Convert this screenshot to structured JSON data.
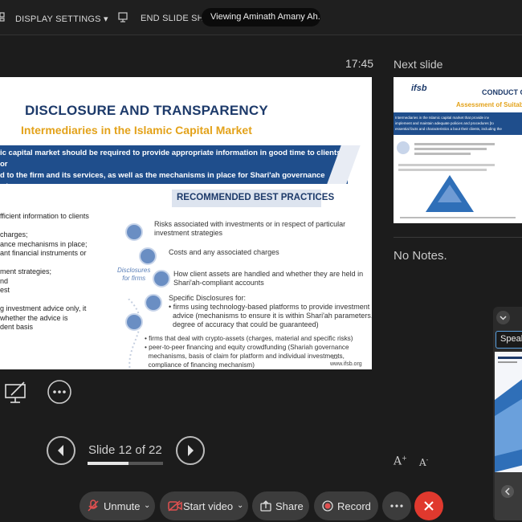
{
  "toolbar_top": {
    "display_settings": "DISPLAY SETTINGS ▾",
    "end_slide_show": "END SLIDE SHOW",
    "viewing": "Viewing Aminath Amany Ah..."
  },
  "presenter": {
    "timer": "17:45",
    "slide_counter": "Slide 12 of 22",
    "progress": 0.545
  },
  "slide": {
    "title": "DISCLOSURE AND TRANSPARENCY",
    "subtitle": "Intermediaries in the Islamic Capital Market",
    "banner": "ic capital market should be required to provide appropriate information in good time to clients or\nd to the firm and its services, as well as the mechanisms in place for Shari'ah governance where a\ne is made.",
    "recommended": "RECOMMENDED BEST PRACTICES",
    "left_text": "fficient information to clients\n\ncharges;\nance mechanisms in place;\nant financial instruments or\n\nment strategies;\nnd\nest\n\ng investment advice only, it\nwhether the advice is\ndent basis",
    "items": [
      "Risks associated with investments or in respect of particular\ninvestment strategies",
      "Costs and any associated charges",
      "How client assets are handled and whether they are held in\nShari'ah-compliant accounts",
      "Specific Disclosures for:\n• firms using technology-based platforms to provide investment\n  advice (mechanisms to ensure it is within Shari'ah parameters,\n  degree of accuracy that could be guaranteed)",
      "• firms that deal with crypto-assets (charges, material and specific risks)\n• peer-to-peer financing and equity crowdfunding (Shariah governance\n  mechanisms, basis of claim for platform and individual investments,\n  compliance of financing mechanism)"
    ],
    "disclosures_label": "Disclosures\nfor firms",
    "page_number": "12",
    "url": "www.ifsb.org"
  },
  "next_slide": {
    "label": "Next slide",
    "title": "CONDUCT O",
    "subtitle": "Assessment of Suitab",
    "body": "Intermediaries in the Islamic capital market that provide inv\nimplement and maintain adequate policies and procedures [to\nessential facts and characteristics a bout their clients, including the",
    "logo": "ifsb"
  },
  "notes": {
    "text": "No Notes.",
    "font_increase": "A",
    "font_decrease": "A"
  },
  "speaker": {
    "tab": "Speak"
  },
  "bottom_toolbar": {
    "unmute": "Unmute",
    "start_video": "Start video",
    "share": "Share",
    "record": "Record"
  }
}
